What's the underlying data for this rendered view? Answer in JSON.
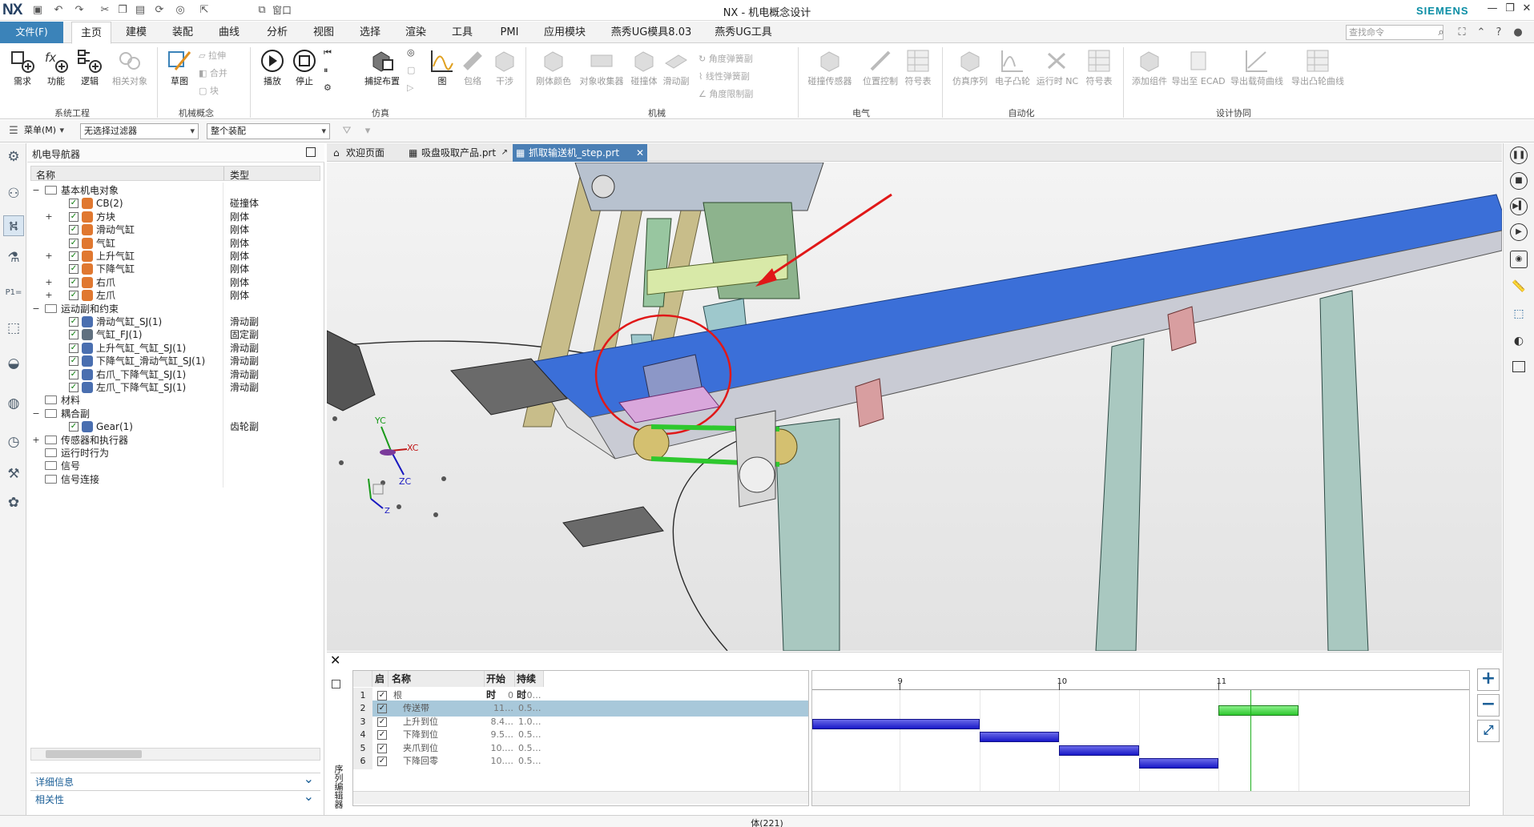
{
  "app": {
    "logo": "NX",
    "title": "NX - 机电概念设计",
    "brand": "SIEMENS",
    "window_menu": "窗口"
  },
  "ribbon_tabs": {
    "file": "文件(F)",
    "tabs": [
      "主页",
      "建模",
      "装配",
      "曲线",
      "分析",
      "视图",
      "选择",
      "渲染",
      "工具",
      "PMI",
      "应用模块",
      "燕秀UG模具8.03",
      "燕秀UG工具"
    ],
    "active": "主页",
    "search_placeholder": "查找命令"
  },
  "ribbon": {
    "system_eng": {
      "buttons": [
        "需求",
        "功能",
        "逻辑",
        "相关对象"
      ],
      "label": "系统工程"
    },
    "mech_concept": {
      "buttons": [
        "草图"
      ],
      "small": [
        "拉伸",
        "合并",
        "块"
      ],
      "label": "机械概念"
    },
    "simulation": {
      "buttons": [
        "播放",
        "停止",
        "捕捉布置",
        "图",
        "包络",
        "干涉"
      ],
      "label": "仿真"
    },
    "mechanical": {
      "buttons": [
        "刚体颜色",
        "对象收集器",
        "碰撞体",
        "滑动副"
      ],
      "small": [
        "角度弹簧副",
        "线性弹簧副",
        "角度限制副"
      ],
      "label": "机械"
    },
    "electrical": {
      "buttons": [
        "碰撞传感器",
        "位置控制",
        "符号表"
      ],
      "label": "电气"
    },
    "automation": {
      "buttons": [
        "仿真序列",
        "电子凸轮",
        "运行时 NC",
        "符号表"
      ],
      "label": "自动化"
    },
    "collaboration": {
      "buttons": [
        "添加组件",
        "导出至 ECAD",
        "导出载荷曲线",
        "导出凸轮曲线"
      ],
      "label": "设计协同"
    }
  },
  "filterbar": {
    "menu": "菜单(M)",
    "filter": "无选择过滤器",
    "scope": "整个装配"
  },
  "navigator": {
    "title": "机电导航器",
    "col_name": "名称",
    "col_type": "类型",
    "rows": [
      {
        "indent": 0,
        "exp": "−",
        "check": false,
        "icon": "folder",
        "name": "基本机电对象",
        "type": ""
      },
      {
        "indent": 1,
        "exp": "",
        "check": true,
        "icon": "collision",
        "name": "CB(2)",
        "type": "碰撞体"
      },
      {
        "indent": 1,
        "exp": "+",
        "check": true,
        "icon": "rigid",
        "name": "方块",
        "type": "刚体"
      },
      {
        "indent": 1,
        "exp": "",
        "check": true,
        "icon": "rigid",
        "name": "滑动气缸",
        "type": "刚体"
      },
      {
        "indent": 1,
        "exp": "",
        "check": true,
        "icon": "rigid",
        "name": "气缸",
        "type": "刚体"
      },
      {
        "indent": 1,
        "exp": "+",
        "check": true,
        "icon": "rigid",
        "name": "上升气缸",
        "type": "刚体"
      },
      {
        "indent": 1,
        "exp": "",
        "check": true,
        "icon": "rigid",
        "name": "下降气缸",
        "type": "刚体"
      },
      {
        "indent": 1,
        "exp": "+",
        "check": true,
        "icon": "rigid",
        "name": "右爪",
        "type": "刚体"
      },
      {
        "indent": 1,
        "exp": "+",
        "check": true,
        "icon": "rigid",
        "name": "左爪",
        "type": "刚体"
      },
      {
        "indent": 0,
        "exp": "−",
        "check": false,
        "icon": "folder",
        "name": "运动副和约束",
        "type": ""
      },
      {
        "indent": 1,
        "exp": "",
        "check": true,
        "icon": "joint",
        "name": "滑动气缸_SJ(1)",
        "type": "滑动副"
      },
      {
        "indent": 1,
        "exp": "",
        "check": true,
        "icon": "fixed",
        "name": "气缸_FJ(1)",
        "type": "固定副"
      },
      {
        "indent": 1,
        "exp": "",
        "check": true,
        "icon": "joint",
        "name": "上升气缸_气缸_SJ(1)",
        "type": "滑动副"
      },
      {
        "indent": 1,
        "exp": "",
        "check": true,
        "icon": "joint",
        "name": "下降气缸_滑动气缸_SJ(1)",
        "type": "滑动副"
      },
      {
        "indent": 1,
        "exp": "",
        "check": true,
        "icon": "joint",
        "name": "右爪_下降气缸_SJ(1)",
        "type": "滑动副"
      },
      {
        "indent": 1,
        "exp": "",
        "check": true,
        "icon": "joint",
        "name": "左爪_下降气缸_SJ(1)",
        "type": "滑动副"
      },
      {
        "indent": 0,
        "exp": "",
        "check": false,
        "icon": "folder",
        "name": "材料",
        "type": ""
      },
      {
        "indent": 0,
        "exp": "−",
        "check": false,
        "icon": "folder",
        "name": "耦合副",
        "type": ""
      },
      {
        "indent": 1,
        "exp": "",
        "check": true,
        "icon": "gear",
        "name": "Gear(1)",
        "type": "齿轮副"
      },
      {
        "indent": 0,
        "exp": "+",
        "check": false,
        "icon": "folder",
        "name": "传感器和执行器",
        "type": ""
      },
      {
        "indent": 0,
        "exp": "",
        "check": false,
        "icon": "folder",
        "name": "运行时行为",
        "type": ""
      },
      {
        "indent": 0,
        "exp": "",
        "check": false,
        "icon": "folder",
        "name": "信号",
        "type": ""
      },
      {
        "indent": 0,
        "exp": "",
        "check": false,
        "icon": "folder",
        "name": "信号连接",
        "type": ""
      }
    ],
    "panels": [
      "详细信息",
      "相关性"
    ]
  },
  "doc_tabs": [
    {
      "label": "欢迎页面",
      "active": false
    },
    {
      "label": "吸盘吸取产品.prt",
      "active": false
    },
    {
      "label": "抓取输送机_step.prt",
      "active": true
    }
  ],
  "viewport": {
    "triad_labels": [
      "YC",
      "XC",
      "ZC",
      "Z"
    ]
  },
  "sequence_editor": {
    "title": "序列编辑器",
    "headers": [
      "启",
      "名称",
      "开始时",
      "持续时"
    ],
    "rows": [
      {
        "n": "1",
        "name": "根",
        "start": "0",
        "duration": "3.0…"
      },
      {
        "n": "2",
        "name": "传送带",
        "start": "11…",
        "duration": "0.5…"
      },
      {
        "n": "3",
        "name": "上升到位",
        "start": "8.4…",
        "duration": "1.0…"
      },
      {
        "n": "4",
        "name": "下降到位",
        "start": "9.5…",
        "duration": "0.5…"
      },
      {
        "n": "5",
        "name": "夹爪到位",
        "start": "10.…",
        "duration": "0.5…"
      },
      {
        "n": "6",
        "name": "下降回零",
        "start": "10.…",
        "duration": "0.5…"
      }
    ],
    "ticks": [
      "9",
      "10",
      "11"
    ],
    "bars": [
      {
        "row": 2,
        "start": 11.0,
        "end": 11.5,
        "color": "green"
      },
      {
        "row": 3,
        "start": 8.45,
        "end": 9.5,
        "color": "blue"
      },
      {
        "row": 4,
        "start": 9.5,
        "end": 10.0,
        "color": "blue"
      },
      {
        "row": 5,
        "start": 10.0,
        "end": 10.5,
        "color": "blue"
      },
      {
        "row": 6,
        "start": 10.5,
        "end": 11.0,
        "color": "blue"
      }
    ],
    "playhead": 11.2
  },
  "status": "体(221)",
  "colors": {
    "accent": "#3b83b9",
    "siemens": "#0a8ea5",
    "belt": "#3b6fd8",
    "highlight": "#d0305a"
  }
}
